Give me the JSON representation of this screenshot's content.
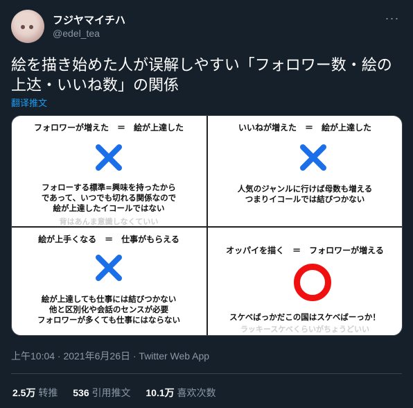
{
  "author": {
    "display_name": "フジヤマイチハ",
    "handle": "@edel_tea"
  },
  "tweet": {
    "text": "絵を描き始めた人が误解しやすい「フォロワー数・絵の上达・いいね数」の関係",
    "translate_label": "翻译推文"
  },
  "image": {
    "panels": [
      {
        "title": "フォロワーが増えた　＝　絵が上達した",
        "mark": "cross",
        "body": [
          "フォローする標準=興味を持ったから",
          "であって、いつでも切れる関係なので",
          "絵が上達したイコールではない"
        ],
        "faint": "背はあんま意識しなくていい"
      },
      {
        "title": "いいねが増えた　＝　絵が上達した",
        "mark": "cross",
        "body": [
          "人気のジャンルに行けば母数も増える",
          "つまりイコールでは結びつかない"
        ],
        "faint": ""
      },
      {
        "title": "絵が上手くなる　＝　仕事がもらえる",
        "mark": "cross",
        "body": [
          "絵が上達しても仕事には結びつかない",
          "他と区別化や会話のセンスが必要",
          "フォロワーが多くても仕事にはならない"
        ],
        "faint": ""
      },
      {
        "title": "オッパイを描く　＝　フォロワーが増える",
        "mark": "circle",
        "body": [
          "スケベばっかだこの国はスケベばーっか！"
        ],
        "faint": "ラッキースケベくらいがちょうどいい"
      }
    ],
    "colors": {
      "cross": "#1b6fe8",
      "circle": "#f01010"
    }
  },
  "meta": {
    "timestamp": "上午10:04 · 2021年6月26日 · Twitter Web App"
  },
  "stats": {
    "retweets_num": "2.5万",
    "retweets_label": "转推",
    "quotes_num": "536",
    "quotes_label": "引用推文",
    "likes_num": "10.1万",
    "likes_label": "喜欢次数"
  }
}
